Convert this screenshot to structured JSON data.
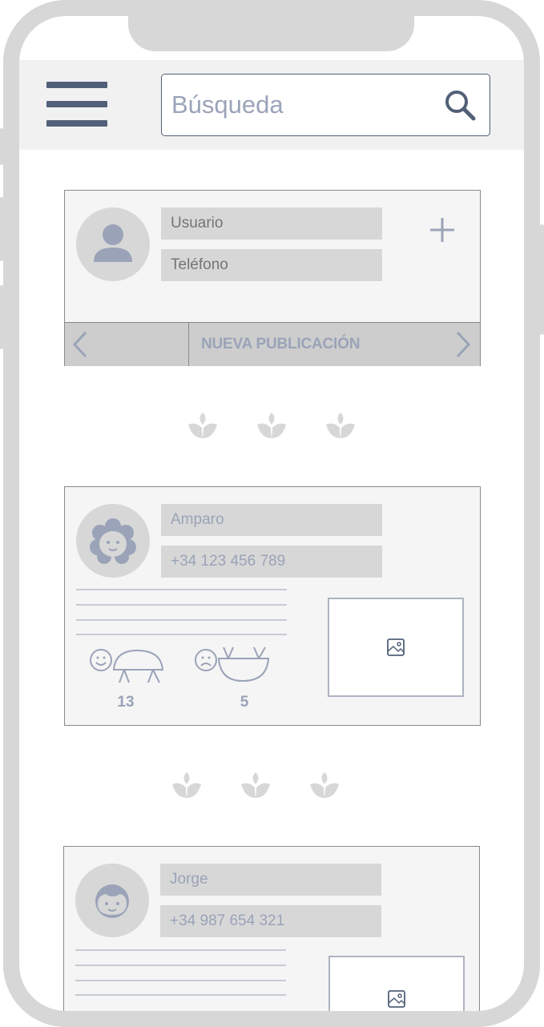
{
  "header": {
    "search_placeholder": "Búsqueda"
  },
  "composer": {
    "user_placeholder": "Usuario",
    "phone_placeholder": "Teléfono",
    "new_post_label": "NUEVA PUBLICACIÓN"
  },
  "posts": [
    {
      "name": "Amparo",
      "phone": "+34 123 456 789",
      "likes": "13",
      "dislikes": "5"
    },
    {
      "name": "Jorge",
      "phone": "+34 987 654 321"
    }
  ],
  "colors": {
    "frame": "#d7d7d7",
    "accent": "#526078",
    "muted_text": "#9aa3b8",
    "field_bg": "#d7d7d7",
    "card_bg": "#f5f5f5"
  },
  "icons": [
    "hamburger-menu-icon",
    "search-icon",
    "user-avatar-icon",
    "plus-icon",
    "chevron-left-icon",
    "chevron-right-icon",
    "lotus-icon",
    "girl-avatar-icon",
    "boy-avatar-icon",
    "like-icon",
    "dislike-icon",
    "image-icon"
  ]
}
